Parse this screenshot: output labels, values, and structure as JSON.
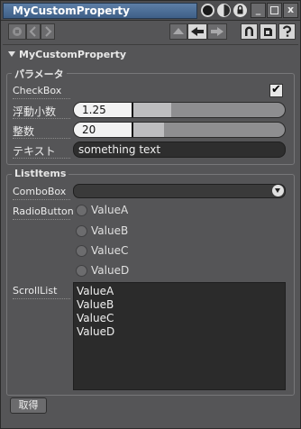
{
  "window": {
    "title": "MyCustomProperty"
  },
  "titlebar": {
    "minimize_label": "_",
    "close_label": "x"
  },
  "header": {
    "title": "MyCustomProperty"
  },
  "parameters": {
    "group_title": "パラメータ",
    "checkbox_label": "CheckBox",
    "checkbox_checked": true,
    "checkbox_mark": "✔",
    "float_label": "浮動小数",
    "float_value": "1.25",
    "float_fill_fraction": 0.25,
    "int_label": "整数",
    "int_value": "20",
    "int_fill_fraction": 0.2,
    "text_label": "テキスト",
    "text_value": "something text"
  },
  "listitems": {
    "group_title": "ListItems",
    "combo_label": "ComboBox",
    "combo_value": "",
    "radio_label": "RadioButton",
    "radio_options": [
      "ValueA",
      "ValueB",
      "ValueC",
      "ValueD"
    ],
    "scrolllist_label": "ScrollList",
    "scroll_items": [
      "ValueA",
      "ValueB",
      "ValueC",
      "ValueD"
    ]
  },
  "footer": {
    "cancel_label": "取得"
  },
  "colors": {
    "title_tab": "#4d6f98",
    "panel": "#555557",
    "field_dark": "#2b2b2b"
  }
}
